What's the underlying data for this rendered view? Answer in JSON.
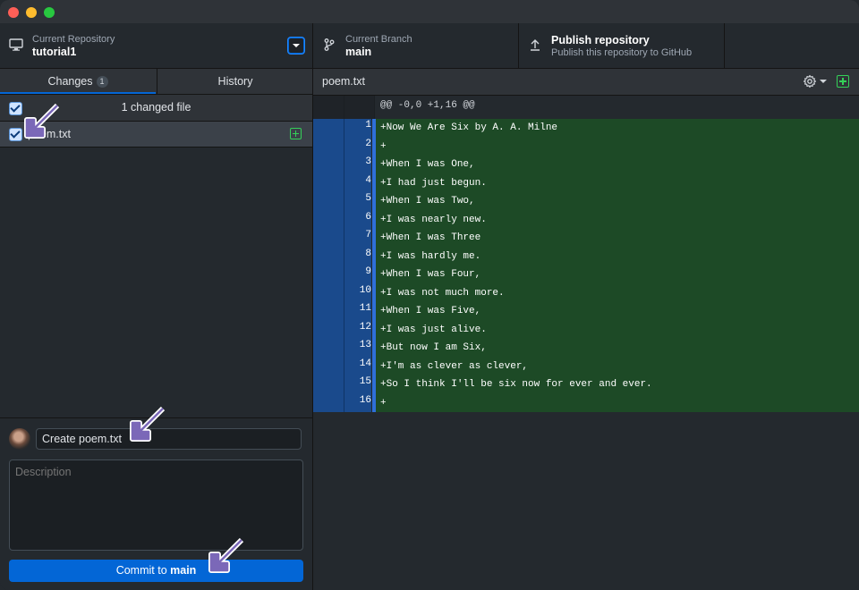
{
  "toolbar": {
    "repository": {
      "label": "Current Repository",
      "value": "tutorial1"
    },
    "branch": {
      "label": "Current Branch",
      "value": "main"
    },
    "publish": {
      "title": "Publish repository",
      "subtitle": "Publish this repository to GitHub"
    }
  },
  "sidebar": {
    "tabs": [
      {
        "label": "Changes",
        "badge": "1"
      },
      {
        "label": "History"
      }
    ],
    "changed_files_title": "1 changed file",
    "files": [
      {
        "name": "poem.txt",
        "status": "added"
      }
    ]
  },
  "commit": {
    "summary_value": "Create poem.txt",
    "description_placeholder": "Description",
    "button_prefix": "Commit to ",
    "button_branch": "main"
  },
  "diff": {
    "filename": "poem.txt",
    "hunk_header": "@@ -0,0 +1,16 @@",
    "lines": [
      {
        "num": "1",
        "text": "+Now We Are Six by A. A. Milne"
      },
      {
        "num": "2",
        "text": "+"
      },
      {
        "num": "3",
        "text": "+When I was One,"
      },
      {
        "num": "4",
        "text": "+I had just begun."
      },
      {
        "num": "5",
        "text": "+When I was Two,"
      },
      {
        "num": "6",
        "text": "+I was nearly new."
      },
      {
        "num": "7",
        "text": "+When I was Three"
      },
      {
        "num": "8",
        "text": "+I was hardly me."
      },
      {
        "num": "9",
        "text": "+When I was Four,"
      },
      {
        "num": "10",
        "text": "+I was not much more."
      },
      {
        "num": "11",
        "text": "+When I was Five,"
      },
      {
        "num": "12",
        "text": "+I was just alive."
      },
      {
        "num": "13",
        "text": "+But now I am Six,"
      },
      {
        "num": "14",
        "text": "+I'm as clever as clever,"
      },
      {
        "num": "15",
        "text": "+So I think I'll be six now for ever and ever."
      },
      {
        "num": "16",
        "text": "+"
      }
    ]
  },
  "colors": {
    "accent": "#0366d6",
    "added_line_bg": "#1d4a26",
    "gutter_bg": "#1a4a8c",
    "annotation_arrow": "#7b68b8"
  }
}
